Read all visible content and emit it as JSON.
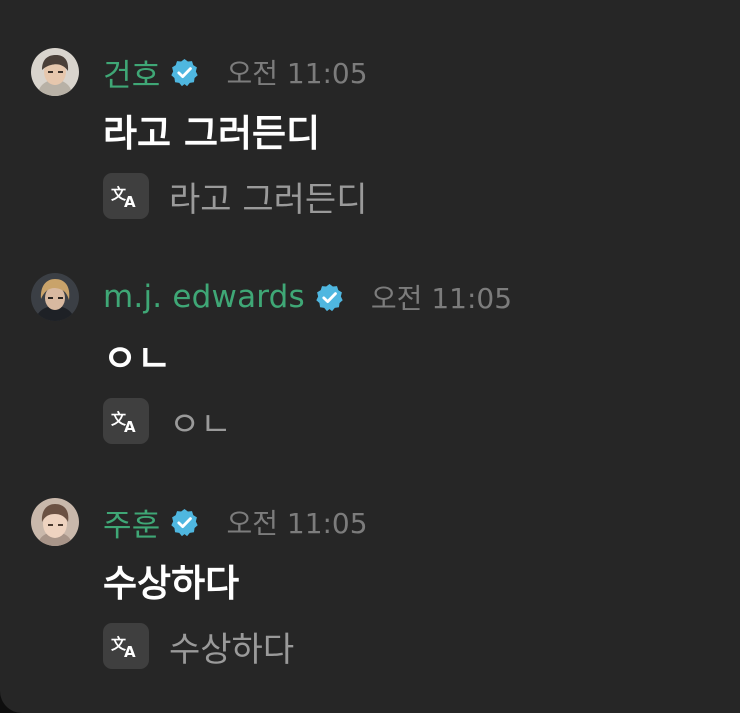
{
  "messages": [
    {
      "username": "건호",
      "verified": true,
      "time": "오전 11:05",
      "text": "라고 그러든디",
      "translation": "라고 그러든디",
      "avatar": "user-avatar"
    },
    {
      "username": "m.j. edwards",
      "verified": true,
      "time": "오전 11:05",
      "text": "ㅇㄴ",
      "translation": "ㅇㄴ",
      "avatar": "user-avatar"
    },
    {
      "username": "주훈",
      "verified": true,
      "time": "오전 11:05",
      "text": "수상하다",
      "translation": "수상하다",
      "avatar": "user-avatar"
    }
  ],
  "icons": {
    "verified": "verified-badge-icon",
    "translate": "translate-icon"
  },
  "colors": {
    "background": "#262626",
    "username": "#3fa776",
    "verified_badge": "#4fb7e0",
    "timestamp": "#7c7c7c",
    "message_text": "#ffffff",
    "translated_text": "#9a9a9a",
    "translate_button": "#3f3f3f"
  }
}
